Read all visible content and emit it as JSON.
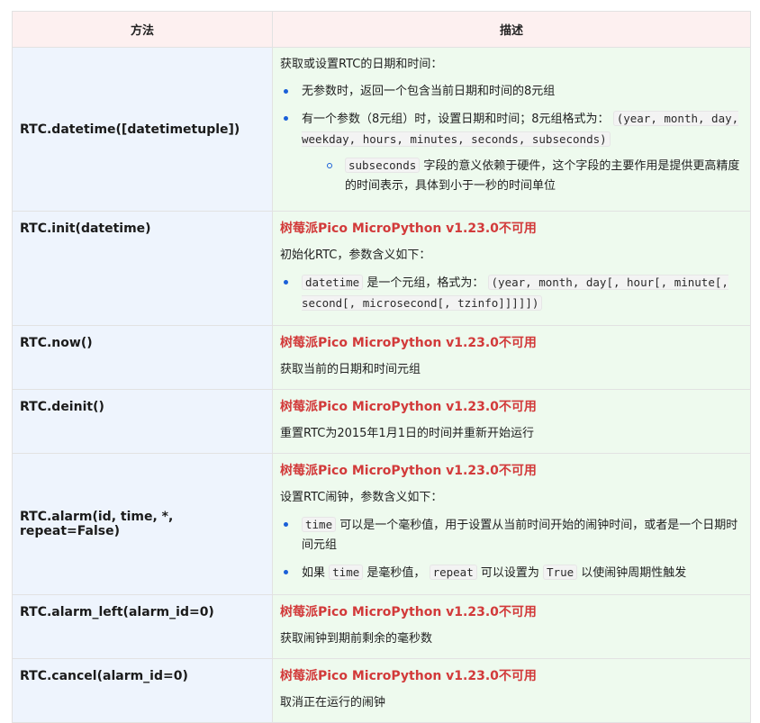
{
  "headers": {
    "method": "方法",
    "description": "描述"
  },
  "unavailable": "树莓派Pico MicroPython v1.23.0不可用",
  "rows": [
    {
      "method": "RTC.datetime([datetimetuple])",
      "intro": "获取或设置RTC的日期和时间：",
      "b1": "无参数时，返回一个包含当前日期和时间的8元组",
      "b2_text": "有一个参数（8元组）时，设置日期和时间；8元组格式为：",
      "b2_code": "(year, month, day, weekday, hours, minutes, seconds, subseconds)",
      "s1_code": "subseconds",
      "s1_text": "字段的意义依赖于硬件，这个字段的主要作用是提供更高精度的时间表示，具体到小于一秒的时间单位"
    },
    {
      "method": "RTC.init(datetime)",
      "intro": "初始化RTC，参数含义如下：",
      "b1_code": "datetime",
      "b1_text": "是一个元组，格式为：",
      "b1_code2": "(year, month, day[, hour[, minute[, second[, microsecond[, tzinfo]]]]])"
    },
    {
      "method": "RTC.now()",
      "text": "获取当前的日期和时间元组"
    },
    {
      "method": "RTC.deinit()",
      "text": "重置RTC为2015年1月1日的时间并重新开始运行"
    },
    {
      "method": "RTC.alarm(id, time, *, repeat=False)",
      "intro": "设置RTC闹钟，参数含义如下：",
      "b1_code": "time",
      "b1_text": "可以是一个毫秒值，用于设置从当前时间开始的闹钟时间，或者是一个日期时间元组",
      "b2_pre": "如果",
      "b2_code": "time",
      "b2_mid": "是毫秒值，",
      "b2_code2": "repeat",
      "b2_mid2": "可以设置为",
      "b2_code3": "True",
      "b2_post": "以使闹钟周期性触发"
    },
    {
      "method": "RTC.alarm_left(alarm_id=0)",
      "text": "获取闹钟到期前剩余的毫秒数"
    },
    {
      "method": "RTC.cancel(alarm_id=0)",
      "text": "取消正在运行的闹钟"
    }
  ],
  "colors": {
    "header_bg": "#fdf0f0",
    "method_bg": "#eef4fd",
    "desc_bg": "#eefaee",
    "warning": "#d23a3a",
    "bullet": "#1a5fd8"
  }
}
